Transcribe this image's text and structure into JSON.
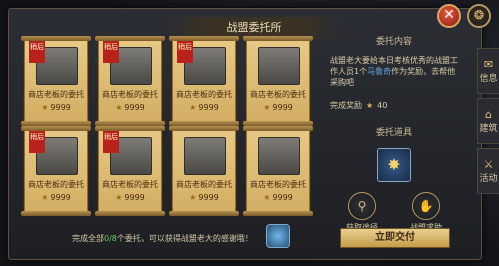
{
  "window": {
    "title": "战盟委托所",
    "close_glyph": "✕",
    "top_right_glyph": "❂"
  },
  "side_tabs": [
    {
      "label": "信息",
      "icon": "info-icon"
    },
    {
      "label": "建筑",
      "icon": "building-icon"
    },
    {
      "label": "活动",
      "icon": "activity-icon"
    }
  ],
  "cards": [
    {
      "title": "商店老板的委托",
      "reward": "9999",
      "ribbon": "稍后",
      "image_text": ""
    },
    {
      "title": "商店老板的委托",
      "reward": "9999",
      "ribbon": "稍后",
      "image_text": ""
    },
    {
      "title": "商店老板的委托",
      "reward": "9999",
      "ribbon": "稍后",
      "image_text": ""
    },
    {
      "title": "商店老板的委托",
      "reward": "9999",
      "ribbon": "",
      "image_text": ""
    },
    {
      "title": "商店老板的委托",
      "reward": "9999",
      "ribbon": "稍后",
      "image_text": ""
    },
    {
      "title": "商店老板的委托",
      "reward": "9999",
      "ribbon": "稍后",
      "image_text": ""
    },
    {
      "title": "商店老板的委托",
      "reward": "9999",
      "ribbon": "",
      "image_text": ""
    },
    {
      "title": "商店老板的委托",
      "reward": "9999",
      "ribbon": "",
      "image_text": ""
    }
  ],
  "footer": {
    "prefix": "完成全部",
    "progress": "0/8",
    "suffix": "个委托，可以获得战盟老大的感谢哦！"
  },
  "right_panel": {
    "content_title": "委托内容",
    "description_part1": "战盟老大要给本日考核优秀的战盟工作人员1个",
    "description_highlight": "马鲁奇",
    "description_part2": "作为奖励，去帮他采购吧",
    "reward_label": "完成奖励",
    "reward_value": "40",
    "item_title": "委托道具",
    "actions": [
      {
        "label": "获取途径",
        "glyph": "⚲"
      },
      {
        "label": "战盟求助",
        "glyph": "✋"
      }
    ],
    "submit_label": "立即交付"
  }
}
